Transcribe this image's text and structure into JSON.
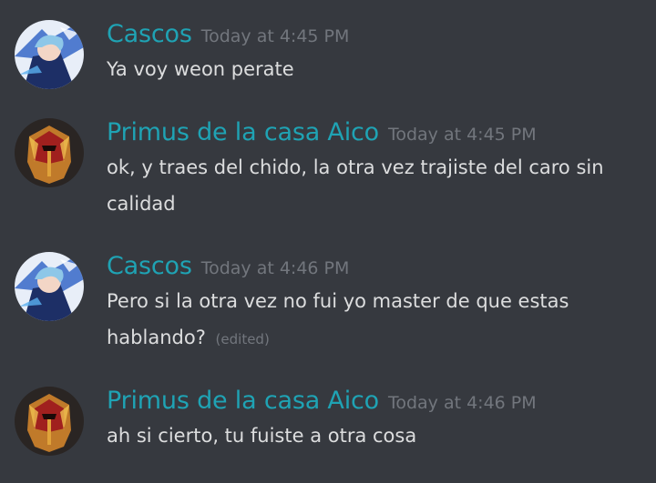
{
  "colors": {
    "background": "#36393f",
    "username": "#1fa3b4",
    "timestamp": "#72767d",
    "message_text": "#dcddde"
  },
  "messages": [
    {
      "author": "Cascos",
      "timestamp": "Today at 4:45 PM",
      "avatar": "blue-haired-anime-character-avatar",
      "text": "Ya voy weon perate",
      "edited_label": ""
    },
    {
      "author": "Primus de la casa Aico",
      "timestamp": "Today at 4:45 PM",
      "avatar": "red-gold-warrior-helmet-avatar",
      "text": "ok, y traes del chido, la otra vez trajiste del caro sin calidad",
      "edited_label": ""
    },
    {
      "author": "Cascos",
      "timestamp": "Today at 4:46 PM",
      "avatar": "blue-haired-anime-character-avatar",
      "text": "Pero si la otra vez no fui yo master de que estas hablando?",
      "edited_label": "(edited)"
    },
    {
      "author": "Primus de la casa Aico",
      "timestamp": "Today at 4:46 PM",
      "avatar": "red-gold-warrior-helmet-avatar",
      "text": "ah si cierto, tu fuiste a otra cosa",
      "edited_label": ""
    }
  ]
}
